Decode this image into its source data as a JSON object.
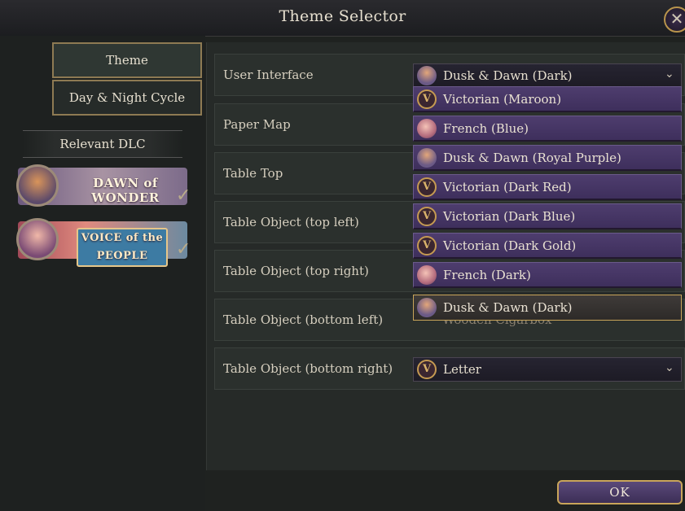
{
  "window": {
    "title": "Theme Selector",
    "close_symbol": "✕"
  },
  "tabs": [
    {
      "label": "Theme",
      "active": true
    },
    {
      "label": "Day & Night Cycle",
      "active": false
    }
  ],
  "dlc": {
    "header": "Relevant DLC",
    "items": [
      {
        "name": "Dawn of Wonder",
        "logo_text": "DAWN of WONDER",
        "owned": true
      },
      {
        "name": "Voice of the People",
        "logo_text": "VOICE of the PEOPLE",
        "owned": true
      }
    ],
    "check_symbol": "✓"
  },
  "settings": [
    {
      "label": "User Interface",
      "value": "Dusk & Dawn (Dark)",
      "icon": "dusk-icon",
      "open": true
    },
    {
      "label": "Paper Map"
    },
    {
      "label": "Table Top"
    },
    {
      "label": "Table Object (top left)"
    },
    {
      "label": "Table Object (top right)"
    },
    {
      "label": "Table Object (bottom left)",
      "value": "Wooden Cigarbox"
    },
    {
      "label": "Table Object (bottom right)",
      "value": "Letter",
      "icon": "victorian-icon"
    }
  ],
  "dropdown_options": [
    {
      "label": "Victorian (Maroon)",
      "icon": "victorian-icon"
    },
    {
      "label": "French (Blue)",
      "icon": "french-icon"
    },
    {
      "label": "Dusk & Dawn (Royal Purple)",
      "icon": "dusk-icon"
    },
    {
      "label": "Victorian (Dark Red)",
      "icon": "victorian-icon"
    },
    {
      "label": "Victorian (Dark Blue)",
      "icon": "victorian-icon"
    },
    {
      "label": "Victorian (Dark Gold)",
      "icon": "victorian-icon"
    },
    {
      "label": "French (Dark)",
      "icon": "french-icon"
    },
    {
      "label": "Dusk & Dawn (Dark)",
      "icon": "dusk-icon",
      "selected": true
    }
  ],
  "chevron_symbol": "⌄",
  "victorian_glyph": "V",
  "ok_label": "OK",
  "colors": {
    "accent_gold": "#c9a55a",
    "option_purple": "#4e3d6e"
  }
}
